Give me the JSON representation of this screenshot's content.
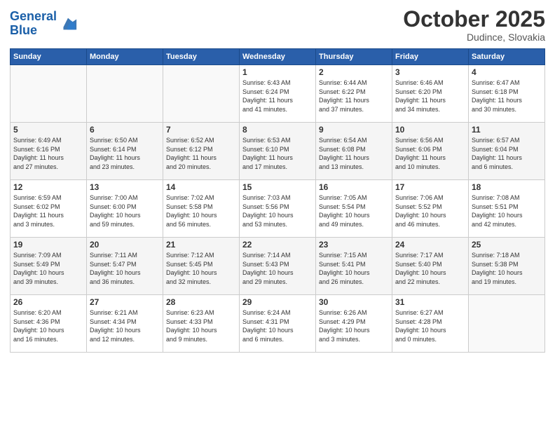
{
  "header": {
    "logo_general": "General",
    "logo_blue": "Blue",
    "month": "October 2025",
    "location": "Dudince, Slovakia"
  },
  "days_of_week": [
    "Sunday",
    "Monday",
    "Tuesday",
    "Wednesday",
    "Thursday",
    "Friday",
    "Saturday"
  ],
  "weeks": [
    [
      {
        "day": "",
        "info": ""
      },
      {
        "day": "",
        "info": ""
      },
      {
        "day": "",
        "info": ""
      },
      {
        "day": "1",
        "info": "Sunrise: 6:43 AM\nSunset: 6:24 PM\nDaylight: 11 hours\nand 41 minutes."
      },
      {
        "day": "2",
        "info": "Sunrise: 6:44 AM\nSunset: 6:22 PM\nDaylight: 11 hours\nand 37 minutes."
      },
      {
        "day": "3",
        "info": "Sunrise: 6:46 AM\nSunset: 6:20 PM\nDaylight: 11 hours\nand 34 minutes."
      },
      {
        "day": "4",
        "info": "Sunrise: 6:47 AM\nSunset: 6:18 PM\nDaylight: 11 hours\nand 30 minutes."
      }
    ],
    [
      {
        "day": "5",
        "info": "Sunrise: 6:49 AM\nSunset: 6:16 PM\nDaylight: 11 hours\nand 27 minutes."
      },
      {
        "day": "6",
        "info": "Sunrise: 6:50 AM\nSunset: 6:14 PM\nDaylight: 11 hours\nand 23 minutes."
      },
      {
        "day": "7",
        "info": "Sunrise: 6:52 AM\nSunset: 6:12 PM\nDaylight: 11 hours\nand 20 minutes."
      },
      {
        "day": "8",
        "info": "Sunrise: 6:53 AM\nSunset: 6:10 PM\nDaylight: 11 hours\nand 17 minutes."
      },
      {
        "day": "9",
        "info": "Sunrise: 6:54 AM\nSunset: 6:08 PM\nDaylight: 11 hours\nand 13 minutes."
      },
      {
        "day": "10",
        "info": "Sunrise: 6:56 AM\nSunset: 6:06 PM\nDaylight: 11 hours\nand 10 minutes."
      },
      {
        "day": "11",
        "info": "Sunrise: 6:57 AM\nSunset: 6:04 PM\nDaylight: 11 hours\nand 6 minutes."
      }
    ],
    [
      {
        "day": "12",
        "info": "Sunrise: 6:59 AM\nSunset: 6:02 PM\nDaylight: 11 hours\nand 3 minutes."
      },
      {
        "day": "13",
        "info": "Sunrise: 7:00 AM\nSunset: 6:00 PM\nDaylight: 10 hours\nand 59 minutes."
      },
      {
        "day": "14",
        "info": "Sunrise: 7:02 AM\nSunset: 5:58 PM\nDaylight: 10 hours\nand 56 minutes."
      },
      {
        "day": "15",
        "info": "Sunrise: 7:03 AM\nSunset: 5:56 PM\nDaylight: 10 hours\nand 53 minutes."
      },
      {
        "day": "16",
        "info": "Sunrise: 7:05 AM\nSunset: 5:54 PM\nDaylight: 10 hours\nand 49 minutes."
      },
      {
        "day": "17",
        "info": "Sunrise: 7:06 AM\nSunset: 5:52 PM\nDaylight: 10 hours\nand 46 minutes."
      },
      {
        "day": "18",
        "info": "Sunrise: 7:08 AM\nSunset: 5:51 PM\nDaylight: 10 hours\nand 42 minutes."
      }
    ],
    [
      {
        "day": "19",
        "info": "Sunrise: 7:09 AM\nSunset: 5:49 PM\nDaylight: 10 hours\nand 39 minutes."
      },
      {
        "day": "20",
        "info": "Sunrise: 7:11 AM\nSunset: 5:47 PM\nDaylight: 10 hours\nand 36 minutes."
      },
      {
        "day": "21",
        "info": "Sunrise: 7:12 AM\nSunset: 5:45 PM\nDaylight: 10 hours\nand 32 minutes."
      },
      {
        "day": "22",
        "info": "Sunrise: 7:14 AM\nSunset: 5:43 PM\nDaylight: 10 hours\nand 29 minutes."
      },
      {
        "day": "23",
        "info": "Sunrise: 7:15 AM\nSunset: 5:41 PM\nDaylight: 10 hours\nand 26 minutes."
      },
      {
        "day": "24",
        "info": "Sunrise: 7:17 AM\nSunset: 5:40 PM\nDaylight: 10 hours\nand 22 minutes."
      },
      {
        "day": "25",
        "info": "Sunrise: 7:18 AM\nSunset: 5:38 PM\nDaylight: 10 hours\nand 19 minutes."
      }
    ],
    [
      {
        "day": "26",
        "info": "Sunrise: 6:20 AM\nSunset: 4:36 PM\nDaylight: 10 hours\nand 16 minutes."
      },
      {
        "day": "27",
        "info": "Sunrise: 6:21 AM\nSunset: 4:34 PM\nDaylight: 10 hours\nand 12 minutes."
      },
      {
        "day": "28",
        "info": "Sunrise: 6:23 AM\nSunset: 4:33 PM\nDaylight: 10 hours\nand 9 minutes."
      },
      {
        "day": "29",
        "info": "Sunrise: 6:24 AM\nSunset: 4:31 PM\nDaylight: 10 hours\nand 6 minutes."
      },
      {
        "day": "30",
        "info": "Sunrise: 6:26 AM\nSunset: 4:29 PM\nDaylight: 10 hours\nand 3 minutes."
      },
      {
        "day": "31",
        "info": "Sunrise: 6:27 AM\nSunset: 4:28 PM\nDaylight: 10 hours\nand 0 minutes."
      },
      {
        "day": "",
        "info": ""
      }
    ]
  ]
}
